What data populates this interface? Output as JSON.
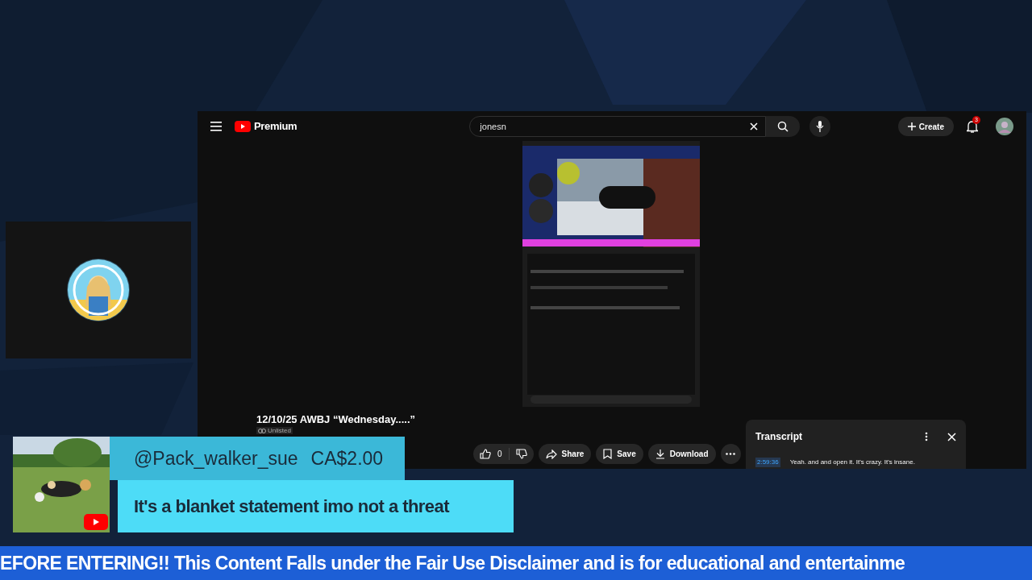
{
  "youtube": {
    "brand": "Premium",
    "search": {
      "value": "jonesn"
    },
    "create": "Create",
    "notifications": "3"
  },
  "video": {
    "title": "12/10/25 AWBJ “Wednesday.....”",
    "visibility": "Unlisted",
    "likes": "0",
    "actions": [
      {
        "kind": "share",
        "label": "Share"
      },
      {
        "kind": "save",
        "label": "Save"
      },
      {
        "kind": "download",
        "label": "Download"
      }
    ]
  },
  "transcript": {
    "title": "Transcript",
    "segments": [
      {
        "time": "2:59:36",
        "text": "Yeah. and and open it. It's crazy. It's insane."
      }
    ]
  },
  "super_chat": {
    "user": "@Pack_walker_sue",
    "amount": "CA$2.00",
    "message": "It's a blanket statement imo not a threat"
  },
  "ticker": "EFORE ENTERING!! This Content Falls under the Fair Use Disclaimer and is for educational and entertainme"
}
